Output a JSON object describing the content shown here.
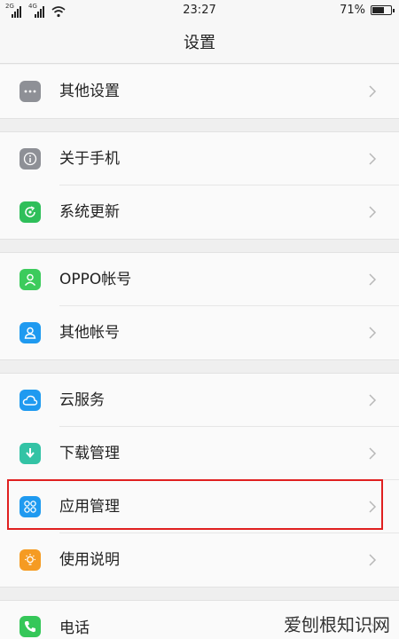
{
  "status_bar": {
    "sim1_label": "2G",
    "sim2_label": "4G",
    "time": "23:27",
    "battery_percent_text": "71%",
    "battery_level": 0.71
  },
  "header": {
    "title": "设置"
  },
  "items": [
    {
      "label": "其他设置",
      "icon": "more-dots-icon",
      "color": "#8e9096"
    },
    {
      "label": "关于手机",
      "icon": "info-icon",
      "color": "#8e9096"
    },
    {
      "label": "系统更新",
      "icon": "update-icon",
      "color": "#2fbf5a"
    },
    {
      "label": "OPPO帐号",
      "icon": "person-icon",
      "color": "#3ccb5c"
    },
    {
      "label": "其他帐号",
      "icon": "person-icon",
      "color": "#1f9af0"
    },
    {
      "label": "云服务",
      "icon": "cloud-icon",
      "color": "#1f9af0"
    },
    {
      "label": "下载管理",
      "icon": "download-icon",
      "color": "#33c3a5"
    },
    {
      "label": "应用管理",
      "icon": "apps-icon",
      "color": "#1f9af0"
    },
    {
      "label": "使用说明",
      "icon": "bulb-icon",
      "color": "#f59b23"
    },
    {
      "label": "电话",
      "icon": "phone-icon",
      "color": "#35c759"
    }
  ],
  "watermark": "爱刨根知识网",
  "highlight_color": "#e02020"
}
